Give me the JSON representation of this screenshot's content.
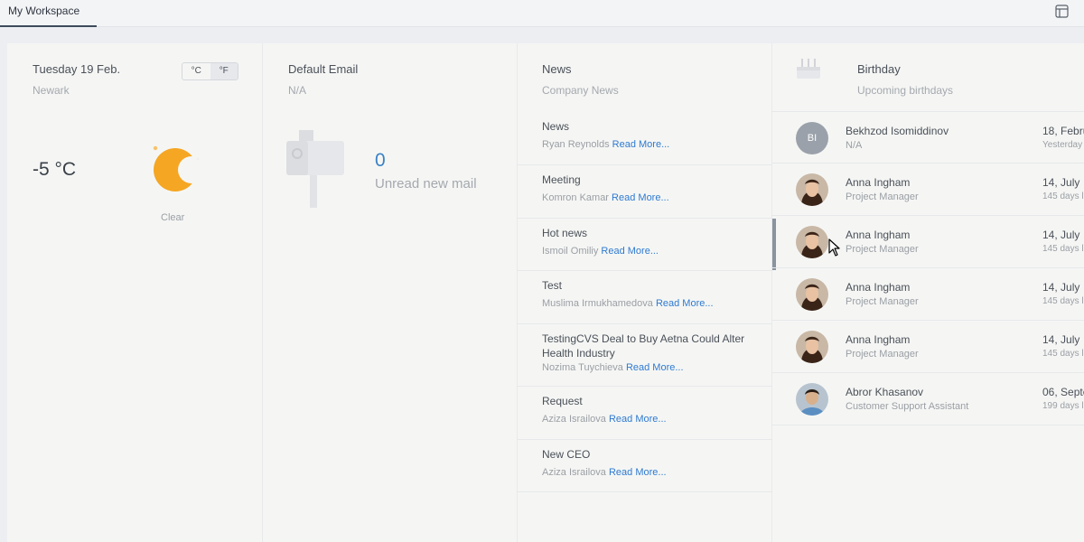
{
  "header": {
    "tab_label": "My Workspace",
    "layout_icon": "layout-icon"
  },
  "weather": {
    "date": "Tuesday 19 Feb.",
    "location": "Newark",
    "unit_c": "°C",
    "unit_f": "°F",
    "temperature": "-5 °C",
    "condition": "Clear",
    "icon": "moon-icon",
    "moon_color": "#f5a623"
  },
  "email": {
    "title": "Default Email",
    "account": "N/A",
    "count": "0",
    "label": "Unread new mail",
    "icon": "mailbox-icon",
    "count_color": "#3b82c4"
  },
  "news": {
    "title": "News",
    "subtitle": "Company News",
    "read_more": "Read More...",
    "items": [
      {
        "title": "News",
        "author": "Ryan Reynolds"
      },
      {
        "title": "Meeting",
        "author": "Komron Kamar"
      },
      {
        "title": "Hot news",
        "author": "Ismoil Omiliy"
      },
      {
        "title": "Test",
        "author": "Muslima Irmukhamedova"
      },
      {
        "title": "TestingCVS Deal to Buy Aetna Could Alter Health Industry",
        "author": "Nozima Tuychieva"
      },
      {
        "title": "Request",
        "author": "Aziza Israilova"
      },
      {
        "title": "New CEO",
        "author": "Aziza Israilova"
      }
    ],
    "link_color": "#2f7ad1"
  },
  "birthday": {
    "title": "Birthday",
    "subtitle": "Upcoming birthdays",
    "icon": "cake-icon",
    "items": [
      {
        "initials": "BI",
        "name": "Bekhzod Isomiddinov",
        "role": "N/A",
        "date": "18, Febru",
        "relative": "Yesterday"
      },
      {
        "initials": "",
        "name": "Anna Ingham",
        "role": "Project Manager",
        "date": "14, July",
        "relative": "145 days l"
      },
      {
        "initials": "",
        "name": "Anna Ingham",
        "role": "Project Manager",
        "date": "14, July",
        "relative": "145 days l"
      },
      {
        "initials": "",
        "name": "Anna Ingham",
        "role": "Project Manager",
        "date": "14, July",
        "relative": "145 days l"
      },
      {
        "initials": "",
        "name": "Anna Ingham",
        "role": "Project Manager",
        "date": "14, July",
        "relative": "145 days l"
      },
      {
        "initials": "",
        "name": "Abror Khasanov",
        "role": "Customer Support Assistant",
        "date": "06, Septe",
        "relative": "199 days l"
      }
    ]
  }
}
